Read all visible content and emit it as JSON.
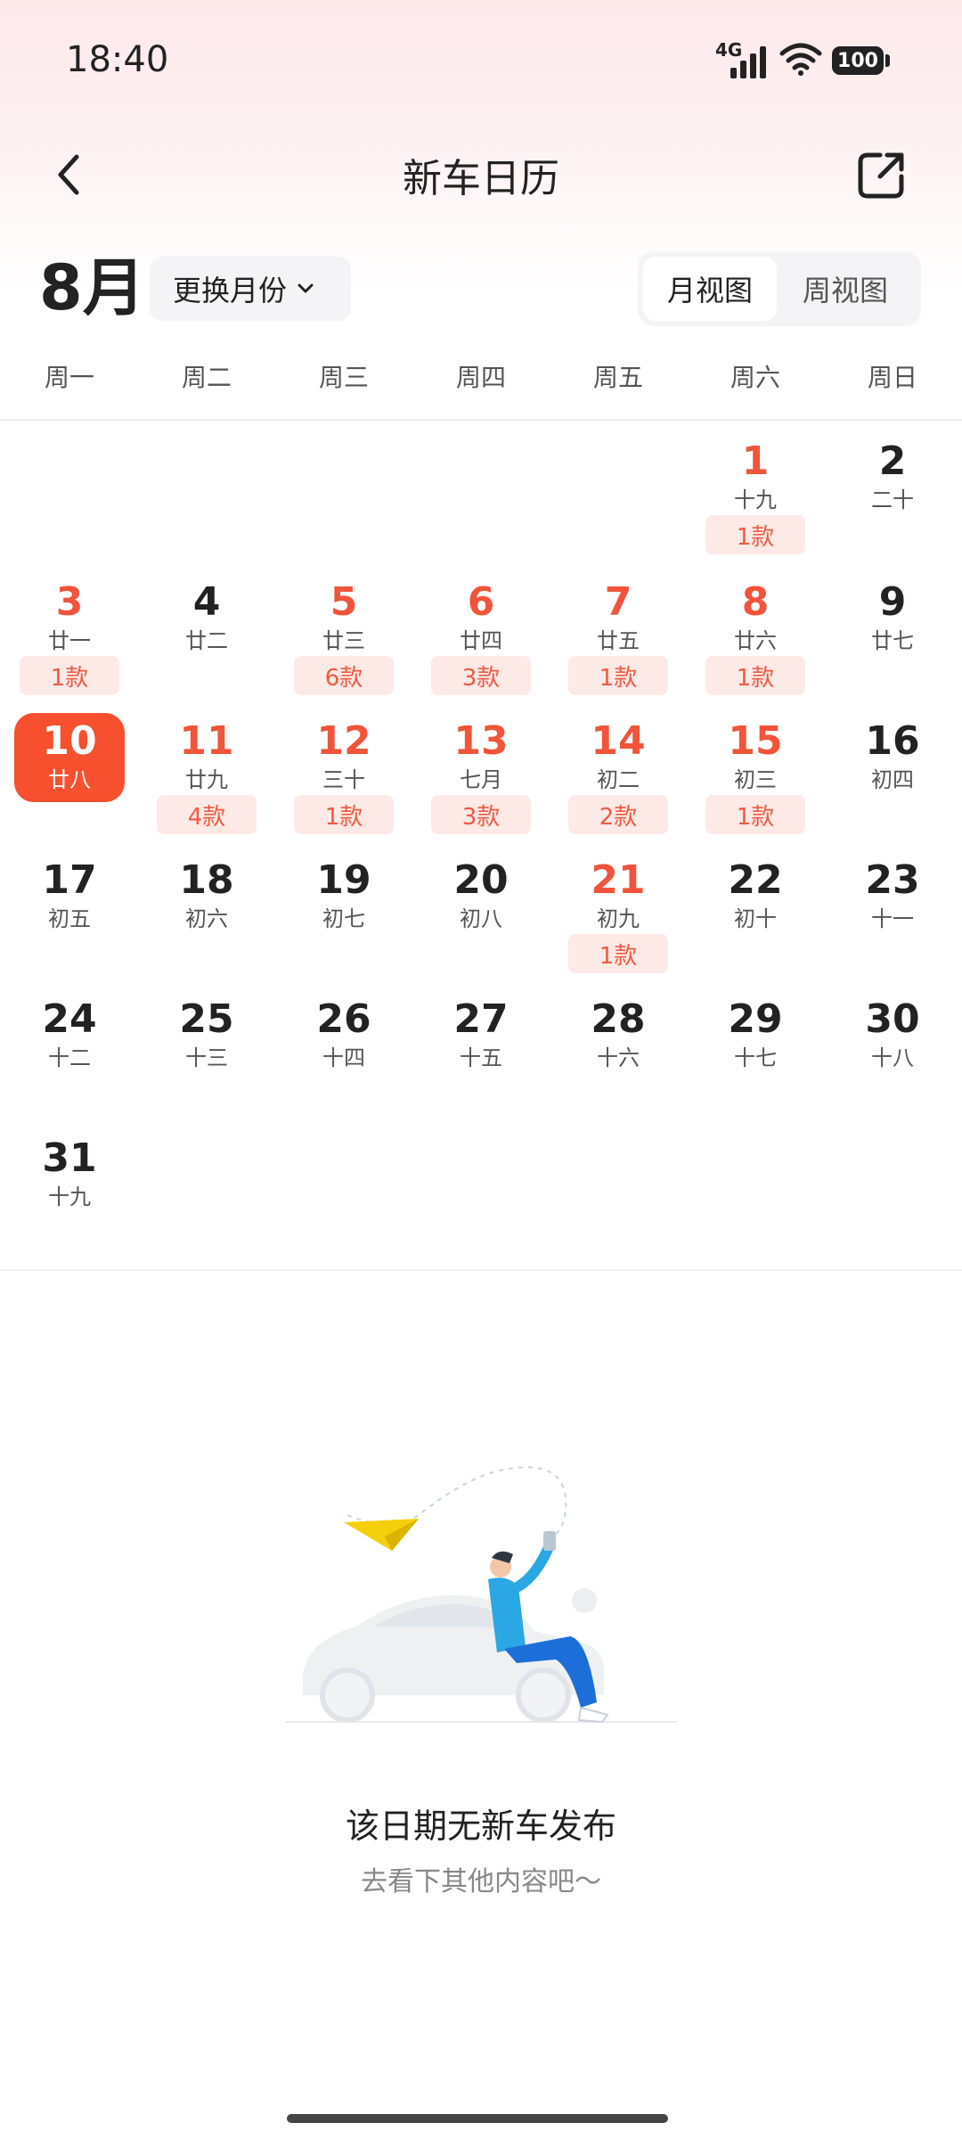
{
  "status": {
    "time": "18:40",
    "network": "4G",
    "battery": "100"
  },
  "nav": {
    "title": "新车日历",
    "back_icon": "chevron-left-icon",
    "share_icon": "share-external-icon"
  },
  "month": {
    "label": "8月",
    "switch_label": "更换月份",
    "view_month": "月视图",
    "view_week": "周视图"
  },
  "weekdays": [
    "周一",
    "周二",
    "周三",
    "周四",
    "周五",
    "周六",
    "周日"
  ],
  "days": [
    {
      "d": "1",
      "l": "十九",
      "badge": "1款",
      "red": true
    },
    {
      "d": "2",
      "l": "二十",
      "badge": "",
      "red": false
    },
    {
      "d": "3",
      "l": "廿一",
      "badge": "1款",
      "red": true
    },
    {
      "d": "4",
      "l": "廿二",
      "badge": "",
      "red": false
    },
    {
      "d": "5",
      "l": "廿三",
      "badge": "6款",
      "red": true
    },
    {
      "d": "6",
      "l": "廿四",
      "badge": "3款",
      "red": true
    },
    {
      "d": "7",
      "l": "廿五",
      "badge": "1款",
      "red": true
    },
    {
      "d": "8",
      "l": "廿六",
      "badge": "1款",
      "red": true
    },
    {
      "d": "9",
      "l": "廿七",
      "badge": "",
      "red": false
    },
    {
      "d": "10",
      "l": "廿八",
      "badge": "",
      "red": false,
      "today": true
    },
    {
      "d": "11",
      "l": "廿九",
      "badge": "4款",
      "red": true
    },
    {
      "d": "12",
      "l": "三十",
      "badge": "1款",
      "red": true
    },
    {
      "d": "13",
      "l": "七月",
      "badge": "3款",
      "red": true
    },
    {
      "d": "14",
      "l": "初二",
      "badge": "2款",
      "red": true
    },
    {
      "d": "15",
      "l": "初三",
      "badge": "1款",
      "red": true
    },
    {
      "d": "16",
      "l": "初四",
      "badge": "",
      "red": false
    },
    {
      "d": "17",
      "l": "初五",
      "badge": "",
      "red": false
    },
    {
      "d": "18",
      "l": "初六",
      "badge": "",
      "red": false
    },
    {
      "d": "19",
      "l": "初七",
      "badge": "",
      "red": false
    },
    {
      "d": "20",
      "l": "初八",
      "badge": "",
      "red": false
    },
    {
      "d": "21",
      "l": "初九",
      "badge": "1款",
      "red": true
    },
    {
      "d": "22",
      "l": "初十",
      "badge": "",
      "red": false
    },
    {
      "d": "23",
      "l": "十一",
      "badge": "",
      "red": false
    },
    {
      "d": "24",
      "l": "十二",
      "badge": "",
      "red": false
    },
    {
      "d": "25",
      "l": "十三",
      "badge": "",
      "red": false
    },
    {
      "d": "26",
      "l": "十四",
      "badge": "",
      "red": false
    },
    {
      "d": "27",
      "l": "十五",
      "badge": "",
      "red": false
    },
    {
      "d": "28",
      "l": "十六",
      "badge": "",
      "red": false
    },
    {
      "d": "29",
      "l": "十七",
      "badge": "",
      "red": false
    },
    {
      "d": "30",
      "l": "十八",
      "badge": "",
      "red": false
    },
    {
      "d": "31",
      "l": "十九",
      "badge": "",
      "red": false
    }
  ],
  "empty": {
    "title": "该日期无新车发布",
    "subtitle": "去看下其他内容吧～"
  },
  "colors": {
    "accent": "#f6502e",
    "red_text": "#f1543a",
    "badge_bg": "#fde9e6"
  }
}
